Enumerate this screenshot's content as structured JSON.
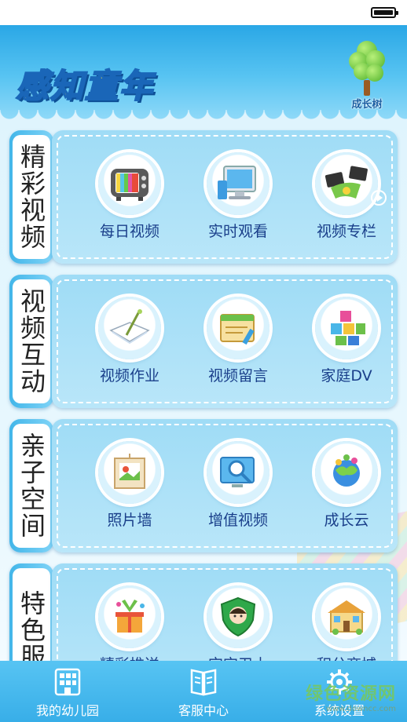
{
  "app": {
    "logo_text": "感知童年",
    "growth_tree_label": "成长树"
  },
  "sections": [
    {
      "label": "精彩视频",
      "items": [
        {
          "label": "每日视频",
          "icon": "tv-icon"
        },
        {
          "label": "实时观看",
          "icon": "monitor-icon"
        },
        {
          "label": "视频专栏",
          "icon": "video-column-icon"
        }
      ]
    },
    {
      "label": "视频互动",
      "items": [
        {
          "label": "视频作业",
          "icon": "homework-icon"
        },
        {
          "label": "视频留言",
          "icon": "message-board-icon"
        },
        {
          "label": "家庭DV",
          "icon": "family-dv-icon"
        }
      ]
    },
    {
      "label": "亲子空间",
      "items": [
        {
          "label": "照片墙",
          "icon": "photo-wall-icon"
        },
        {
          "label": "增值视频",
          "icon": "value-added-video-icon"
        },
        {
          "label": "成长云",
          "icon": "growth-cloud-icon"
        }
      ]
    },
    {
      "label": "特色服",
      "items": [
        {
          "label": "精彩推送",
          "icon": "gift-push-icon"
        },
        {
          "label": "宝宝卫士",
          "icon": "baby-guard-icon"
        },
        {
          "label": "积分商城",
          "icon": "points-mall-icon"
        }
      ]
    }
  ],
  "tabs": [
    {
      "label": "我的幼儿园",
      "icon": "kindergarten-icon"
    },
    {
      "label": "客服中心",
      "icon": "book-icon"
    },
    {
      "label": "系统设置",
      "icon": "gear-icon"
    }
  ],
  "watermark": {
    "text": "绿色资源网",
    "url": "www.downcc.com"
  },
  "colors": {
    "header_blue": "#2aa7e6",
    "panel_blue": "#9fdcf6",
    "label_text": "#1a3f8a",
    "tab_bar": "#38aee8"
  }
}
